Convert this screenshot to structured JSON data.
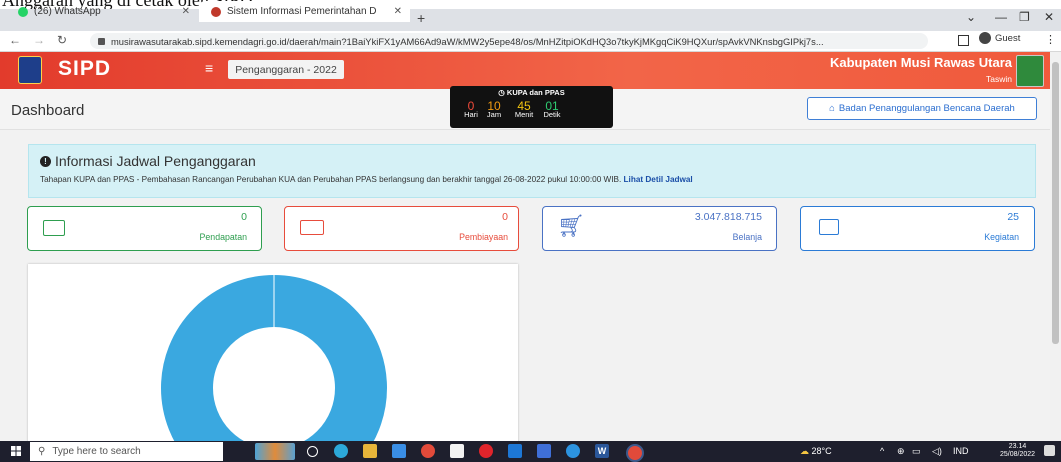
{
  "caption": "Anggaran yang di cetak oleh SIPD",
  "browser": {
    "tabs": [
      {
        "label": "(26) WhatsApp",
        "active": false,
        "favicon_color": "#25d366"
      },
      {
        "label": "Sistem Informasi Pemerintahan D",
        "active": true,
        "favicon_color": "#c0392b"
      }
    ],
    "new_tab": "+",
    "url": "musirawasutarakab.sipd.kemendagri.go.id/daerah/main?1BaiYkiFX1yAM66Ad9aW/kMW2y5epe48/os/MnHZitpiOKdHQ3o7tkyKjMKgqCiK9HQXur/spAvkVNKnsbgGIPkj7s...",
    "profile": "Guest"
  },
  "header": {
    "app_name": "SIPD",
    "period": "Penganggaran - 2022",
    "region": "Kabupaten Musi Rawas Utara",
    "user": "Taswin",
    "accent": "#ef4f38"
  },
  "dashboard": {
    "title": "Dashboard",
    "timer": {
      "label": "KUPA dan PPAS",
      "units": [
        {
          "value": "0",
          "label": "Hari",
          "color": "#f04a3a"
        },
        {
          "value": "10",
          "label": "Jam",
          "color": "#f39c12"
        },
        {
          "value": "45",
          "label": "Menit",
          "color": "#f1c40f"
        },
        {
          "value": "01",
          "label": "Detik",
          "color": "#2ecc71"
        }
      ]
    },
    "agency_button": "Badan Penanggulangan Bencana Daerah"
  },
  "info": {
    "title": "Informasi Jadwal Penganggaran",
    "text": "Tahapan KUPA dan PPAS - Pembahasan Rancangan Perubahan KUA dan Perubahan PPAS berlangsung dan berakhir tanggal 26-08-2022 pukul 10:00:00 WIB.",
    "link": "Lihat Detil Jadwal"
  },
  "cards": [
    {
      "value": "0",
      "label": "Pendapatan",
      "color": "#2e9e4f",
      "icon": "wallet-icon"
    },
    {
      "value": "0",
      "label": "Pembiayaan",
      "color": "#e74c3c",
      "icon": "credit-card-icon"
    },
    {
      "value": "3.047.818.715",
      "label": "Belanja",
      "color": "#4a72c4",
      "icon": "cart-icon"
    },
    {
      "value": "25",
      "label": "Kegiatan",
      "color": "#2b7bd6",
      "icon": "message-icon"
    }
  ],
  "chart": {
    "donut_color": "#3aa8e0",
    "share": 1.0
  },
  "taskbar": {
    "search_placeholder": "Type here to search",
    "weather": "28°C",
    "language": "IND",
    "time": "23.14",
    "date": "25/08/2022"
  }
}
